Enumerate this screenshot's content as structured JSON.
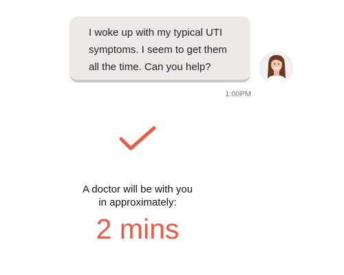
{
  "chat": {
    "message": "I woke up with my typical UTI symptoms. I seem to get them all the time. Can you help?",
    "time": "1:00PM",
    "avatar_icon": "user-avatar-photo"
  },
  "status": {
    "icon": "checkmark-icon",
    "line1": "A doctor will be with you",
    "line2": "in approximately:",
    "eta": "2 mins",
    "accent_color": "#ec5a45"
  }
}
